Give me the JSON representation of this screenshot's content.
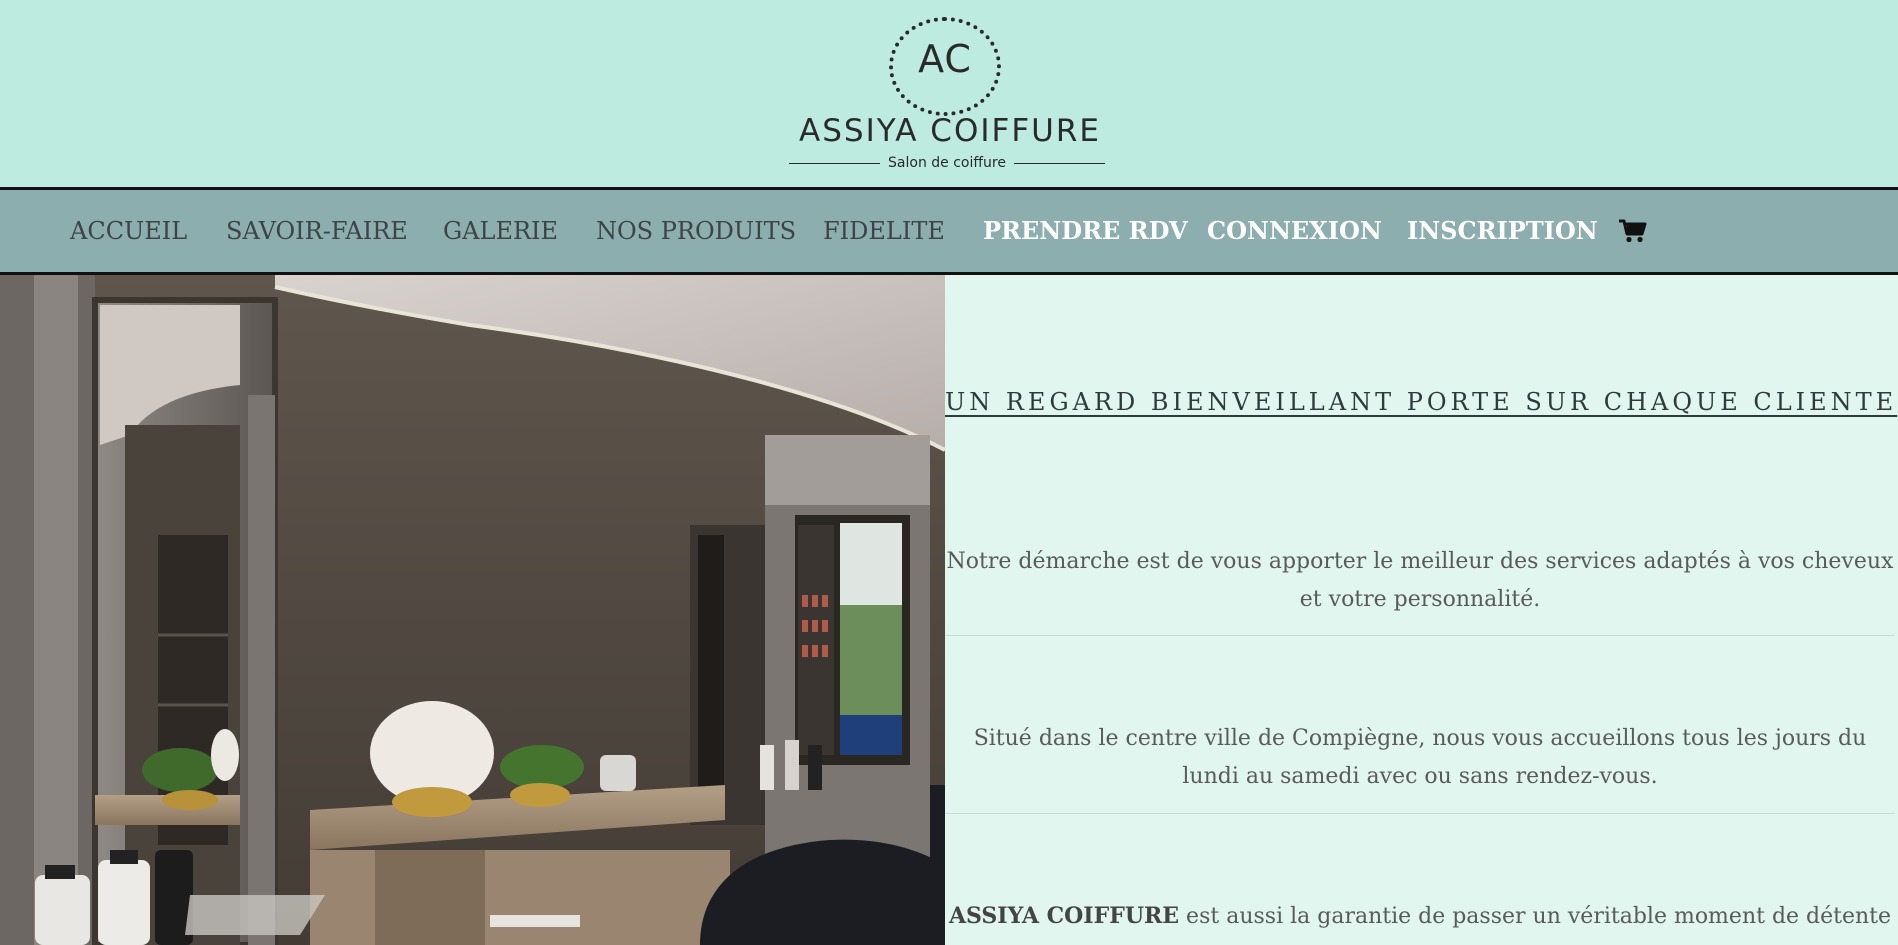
{
  "logo": {
    "initials": "AC",
    "name": "ASSIYA COIFFURE",
    "tagline": "Salon de coiffure"
  },
  "nav": {
    "items": [
      {
        "label": "ACCUEIL"
      },
      {
        "label": "SAVOIR-FAIRE"
      },
      {
        "label": "GALERIE"
      },
      {
        "label": "NOS PRODUITS"
      },
      {
        "label": "FIDELITE"
      },
      {
        "label": "PRENDRE RDV"
      },
      {
        "label": "CONNEXION"
      },
      {
        "label": "INSCRIPTION"
      }
    ],
    "cart_icon": "cart-icon"
  },
  "content": {
    "title": "UN REGARD BIENVEILLANT PORTE SUR CHAQUE CLIENTE",
    "para1_line1": "Notre démarche est de vous apporter le meilleur des services adaptés à vos cheveux",
    "para1_line2": "et votre personnalité.",
    "para2_line1": "Situé dans le centre ville de Compiègne, nous vous accueillons tous les jours du",
    "para2_line2": "lundi au samedi avec ou sans rendez-vous.",
    "para3_brand": "ASSIYA COIFFURE",
    "para3_rest": " est aussi la garantie de passer un véritable moment de détente"
  },
  "colors": {
    "header_bg": "#bdebe0",
    "nav_bg": "#8daeaf",
    "panel_bg": "#e0f6ef"
  }
}
